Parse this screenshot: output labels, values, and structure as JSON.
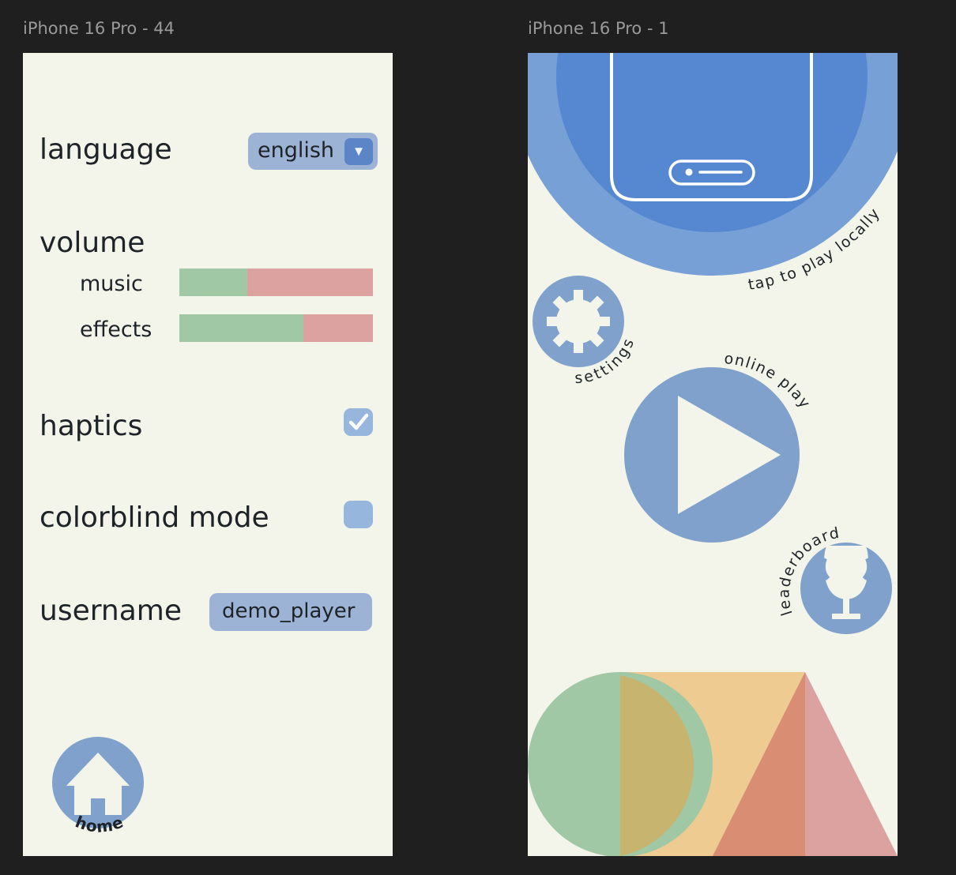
{
  "frames": {
    "left_title": "iPhone 16 Pro - 44",
    "right_title": "iPhone 16 Pro - 1"
  },
  "settings": {
    "language_label": "language",
    "language_value": "english",
    "volume_label": "volume",
    "music_label": "music",
    "music_level": 0.35,
    "effects_label": "effects",
    "effects_level": 0.64,
    "haptics_label": "haptics",
    "haptics_checked": true,
    "colorblind_label": "colorblind mode",
    "colorblind_checked": false,
    "username_label": "username",
    "username_value": "demo_player",
    "home_label": "home"
  },
  "menu": {
    "tap_local_label": "tap to play locally",
    "settings_label": "settings",
    "online_label": "online play",
    "leaderboard_label": "leaderboard"
  },
  "icons": [
    "dropdown-arrow-icon",
    "checkmark-icon",
    "house-icon",
    "phone-icon",
    "gear-icon",
    "play-icon",
    "trophy-icon"
  ],
  "colors": {
    "background": "#f3f5ea",
    "button_blue": "#7fa1cc",
    "field_blue": "#9db3d6",
    "green": "#a0c8a5",
    "red": "#dca2a0",
    "orange": "#eecb90"
  }
}
